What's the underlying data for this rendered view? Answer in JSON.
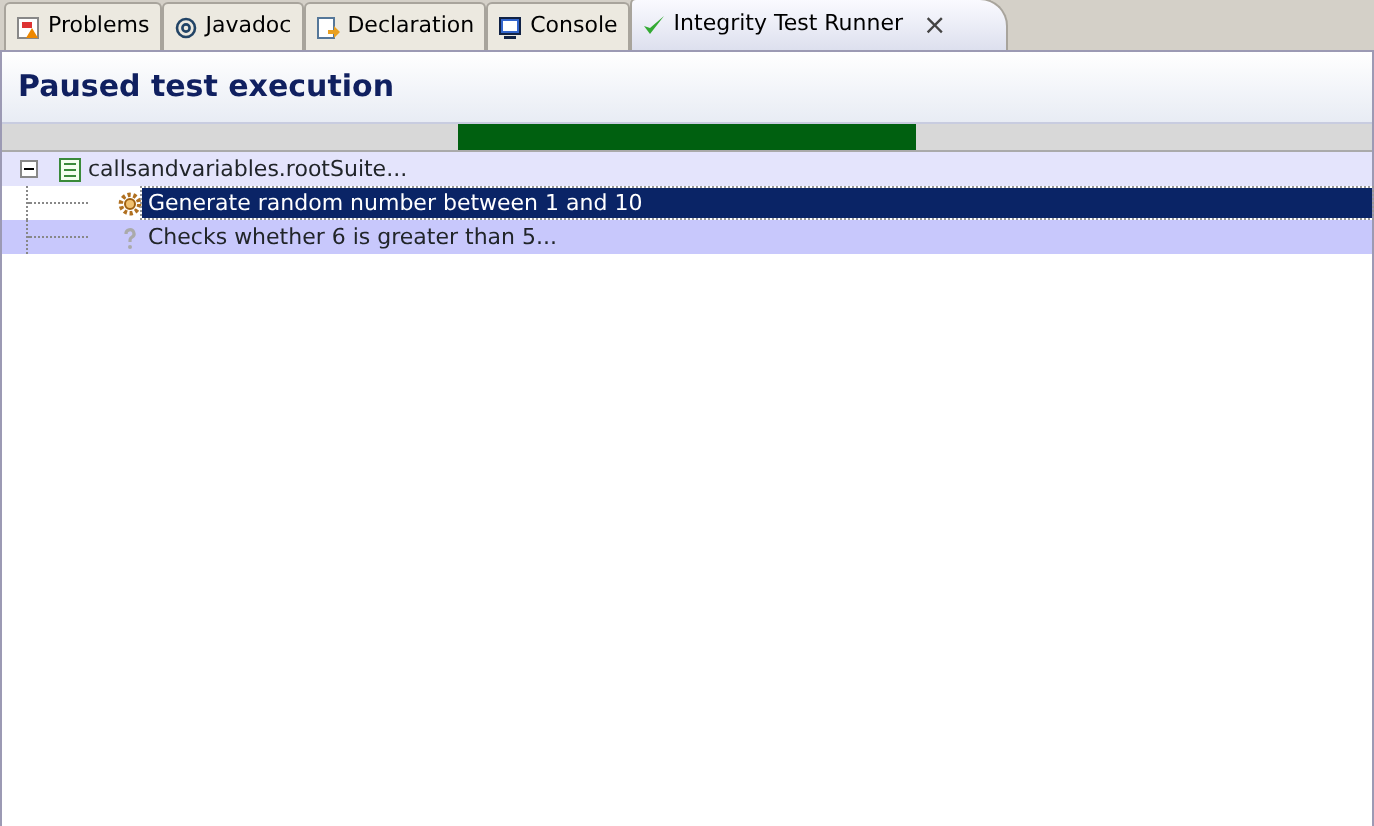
{
  "tabs": [
    {
      "label": "Problems",
      "kind": "problems",
      "selected": false
    },
    {
      "label": "Javadoc",
      "kind": "javadoc",
      "selected": false
    },
    {
      "label": "Declaration",
      "kind": "declaration",
      "selected": false
    },
    {
      "label": "Console",
      "kind": "console",
      "selected": false
    },
    {
      "label": "Integrity Test Runner",
      "kind": "runner",
      "selected": true,
      "close": "×"
    }
  ],
  "header": {
    "title": "Paused test execution"
  },
  "progress_segments": [
    {
      "color": "#d8d8d8"
    },
    {
      "color": "#006010"
    },
    {
      "color": "#d8d8d8"
    }
  ],
  "tree": [
    {
      "label": "callsandvariables.rootSuite...",
      "kind": "suite",
      "expanded": true,
      "selected": false,
      "color": "#e4e4fc",
      "children": [
        {
          "label": "Generate random number between 1 and 10",
          "kind": "call",
          "selected": true,
          "color": "#0a2466"
        },
        {
          "label": "Checks whether 6 is greater than 5...",
          "kind": "test",
          "selected": false,
          "color": "#c8c8fc"
        }
      ]
    }
  ]
}
